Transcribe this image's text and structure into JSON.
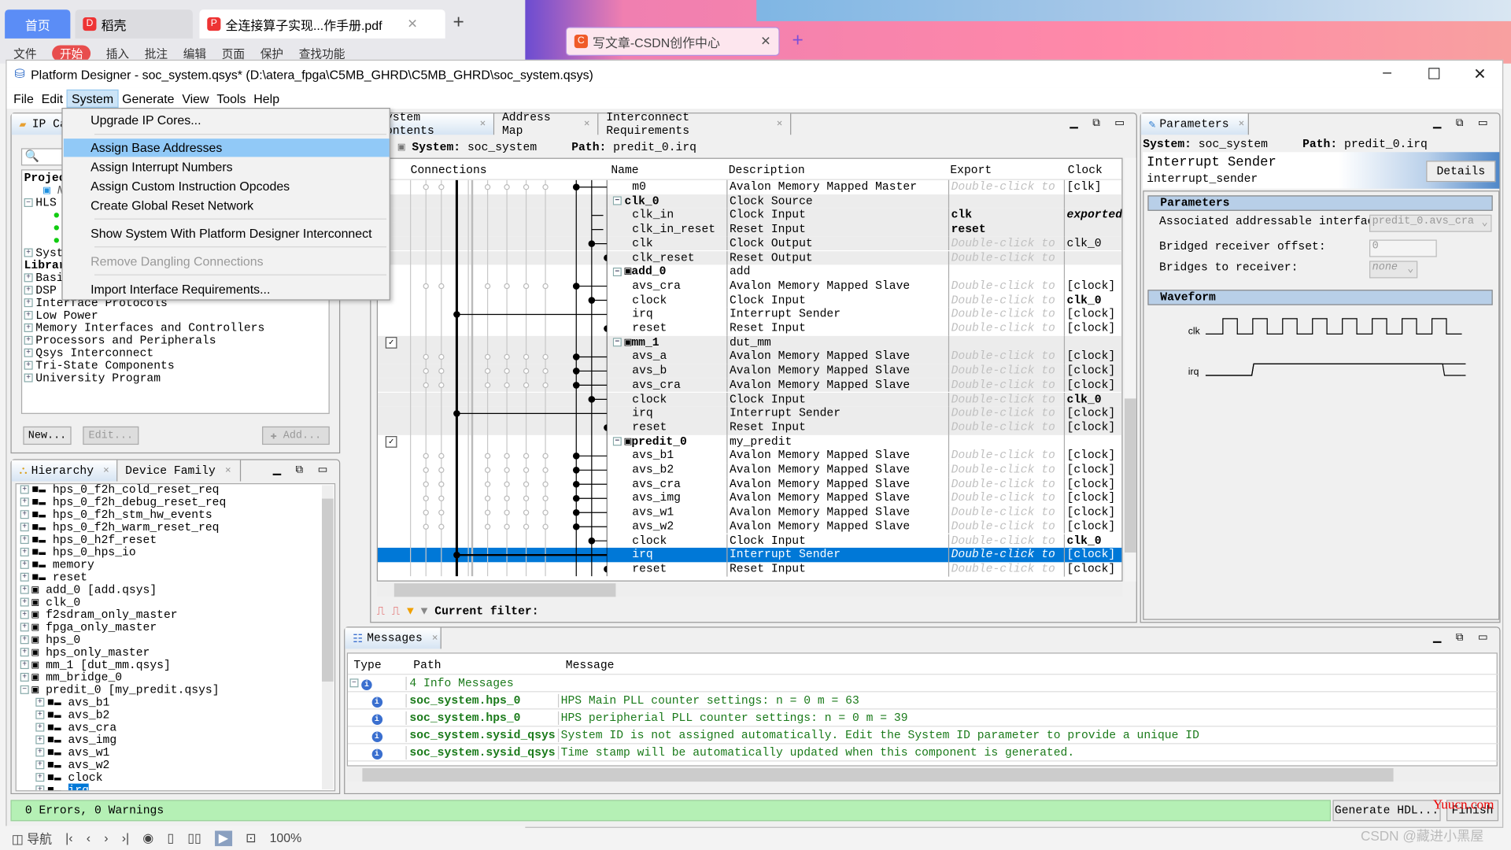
{
  "browser": {
    "tabs": [
      {
        "label": "首页"
      },
      {
        "label": "稻壳"
      },
      {
        "label": "全连接算子实现...作手册.pdf"
      }
    ],
    "toolbar": [
      "文件",
      "开始",
      "插入",
      "批注",
      "编辑",
      "页面",
      "保护",
      "查找功能"
    ],
    "csdn_tab": "写文章-CSDN创作中心"
  },
  "window": {
    "title": "Platform Designer - soc_system.qsys* (D:\\atera_fpga\\C5MB_GHRD\\C5MB_GHRD\\soc_system.qsys)",
    "menu": [
      "File",
      "Edit",
      "System",
      "Generate",
      "View",
      "Tools",
      "Help"
    ],
    "active_menu": "System"
  },
  "system_menu": {
    "items": [
      {
        "label": "Upgrade IP Cores...",
        "enabled": true
      },
      {
        "label": "Assign Base Addresses",
        "enabled": true,
        "highlighted": true
      },
      {
        "label": "Assign Interrupt Numbers",
        "enabled": true
      },
      {
        "label": "Assign Custom Instruction Opcodes",
        "enabled": true
      },
      {
        "label": "Create Global Reset Network",
        "enabled": true
      },
      {
        "label": "Show System With Platform Designer Interconnect",
        "enabled": true
      },
      {
        "label": "Remove Dangling Connections",
        "enabled": false
      },
      {
        "label": "Import Interface Requirements...",
        "enabled": true
      }
    ]
  },
  "ip_catalog": {
    "tab": "IP Catalog",
    "project_label": "Project",
    "project_items": [
      "HLS",
      "System"
    ],
    "library_label": "Library",
    "library_items": [
      "Basic Functions",
      "DSP",
      "Interface Protocols",
      "Low Power",
      "Memory Interfaces and Controllers",
      "Processors and Peripherals",
      "Qsys Interconnect",
      "Tri-State Components",
      "University Program"
    ],
    "buttons": {
      "new": "New...",
      "edit": "Edit...",
      "add": "Add..."
    }
  },
  "hierarchy": {
    "tabs": [
      "Hierarchy",
      "Device Family"
    ],
    "items": [
      "hps_0_f2h_cold_reset_req",
      "hps_0_f2h_debug_reset_req",
      "hps_0_f2h_stm_hw_events",
      "hps_0_f2h_warm_reset_req",
      "hps_0_h2f_reset",
      "hps_0_hps_io",
      "memory",
      "reset",
      "add_0 [add.qsys]",
      "clk_0",
      "f2sdram_only_master",
      "fpga_only_master",
      "hps_0",
      "hps_only_master",
      "mm_1 [dut_mm.qsys]",
      "mm_bridge_0",
      "predit_0 [my_predit.qsys]"
    ],
    "children": [
      "avs_b1",
      "avs_b2",
      "avs_cra",
      "avs_img",
      "avs_w1",
      "avs_w2",
      "clock",
      "irq"
    ],
    "selected": "irq"
  },
  "contents": {
    "tabs": [
      "System Contents",
      "Address Map",
      "Interconnect Requirements"
    ],
    "system_label": "System:",
    "system": "soc_system",
    "path_label": "Path:",
    "path": "predit_0.irq",
    "columns": [
      "Connections",
      "Name",
      "Description",
      "Export",
      "Clock"
    ],
    "rows": [
      {
        "name": "m0",
        "desc": "Avalon Memory Mapped Master",
        "export": "Double-click to",
        "clock": "[clk]",
        "kind": "port"
      },
      {
        "name": "clk_0",
        "desc": "Clock Source",
        "export": "",
        "clock": "",
        "kind": "module"
      },
      {
        "name": "clk_in",
        "desc": "Clock Input",
        "export": "clk",
        "clock": "exported",
        "kind": "port"
      },
      {
        "name": "clk_in_reset",
        "desc": "Reset Input",
        "export": "reset",
        "clock": "",
        "kind": "port"
      },
      {
        "name": "clk",
        "desc": "Clock Output",
        "export": "Double-click to",
        "clock": "clk_0",
        "kind": "port"
      },
      {
        "name": "clk_reset",
        "desc": "Reset Output",
        "export": "Double-click to",
        "clock": "",
        "kind": "port"
      },
      {
        "name": "add_0",
        "desc": "add",
        "export": "",
        "clock": "",
        "kind": "module"
      },
      {
        "name": "avs_cra",
        "desc": "Avalon Memory Mapped Slave",
        "export": "Double-click to",
        "clock": "[clock]",
        "kind": "port"
      },
      {
        "name": "clock",
        "desc": "Clock Input",
        "export": "Double-click to",
        "clock": "clk_0",
        "kind": "port"
      },
      {
        "name": "irq",
        "desc": "Interrupt Sender",
        "export": "Double-click to",
        "clock": "[clock]",
        "kind": "port"
      },
      {
        "name": "reset",
        "desc": "Reset Input",
        "export": "Double-click to",
        "clock": "[clock]",
        "kind": "port"
      },
      {
        "name": "mm_1",
        "desc": "dut_mm",
        "export": "",
        "clock": "",
        "kind": "module"
      },
      {
        "name": "avs_a",
        "desc": "Avalon Memory Mapped Slave",
        "export": "Double-click to",
        "clock": "[clock]",
        "kind": "port"
      },
      {
        "name": "avs_b",
        "desc": "Avalon Memory Mapped Slave",
        "export": "Double-click to",
        "clock": "[clock]",
        "kind": "port"
      },
      {
        "name": "avs_cra",
        "desc": "Avalon Memory Mapped Slave",
        "export": "Double-click to",
        "clock": "[clock]",
        "kind": "port"
      },
      {
        "name": "clock",
        "desc": "Clock Input",
        "export": "Double-click to",
        "clock": "clk_0",
        "kind": "port"
      },
      {
        "name": "irq",
        "desc": "Interrupt Sender",
        "export": "Double-click to",
        "clock": "[clock]",
        "kind": "port"
      },
      {
        "name": "reset",
        "desc": "Reset Input",
        "export": "Double-click to",
        "clock": "[clock]",
        "kind": "port"
      },
      {
        "name": "predit_0",
        "desc": "my_predit",
        "export": "",
        "clock": "",
        "kind": "module"
      },
      {
        "name": "avs_b1",
        "desc": "Avalon Memory Mapped Slave",
        "export": "Double-click to",
        "clock": "[clock]",
        "kind": "port"
      },
      {
        "name": "avs_b2",
        "desc": "Avalon Memory Mapped Slave",
        "export": "Double-click to",
        "clock": "[clock]",
        "kind": "port"
      },
      {
        "name": "avs_cra",
        "desc": "Avalon Memory Mapped Slave",
        "export": "Double-click to",
        "clock": "[clock]",
        "kind": "port"
      },
      {
        "name": "avs_img",
        "desc": "Avalon Memory Mapped Slave",
        "export": "Double-click to",
        "clock": "[clock]",
        "kind": "port"
      },
      {
        "name": "avs_w1",
        "desc": "Avalon Memory Mapped Slave",
        "export": "Double-click to",
        "clock": "[clock]",
        "kind": "port"
      },
      {
        "name": "avs_w2",
        "desc": "Avalon Memory Mapped Slave",
        "export": "Double-click to",
        "clock": "[clock]",
        "kind": "port"
      },
      {
        "name": "clock",
        "desc": "Clock Input",
        "export": "Double-click to",
        "clock": "clk_0",
        "kind": "port"
      },
      {
        "name": "irq",
        "desc": "Interrupt Sender",
        "export": "Double-click to",
        "clock": "[clock]",
        "kind": "port",
        "selected": true
      },
      {
        "name": "reset",
        "desc": "Reset Input",
        "export": "Double-click to",
        "clock": "[clock]",
        "kind": "port"
      }
    ],
    "filter_label": "Current filter:"
  },
  "parameters": {
    "tab": "Parameters",
    "system_label": "System:",
    "system": "soc_system",
    "path_label": "Path:",
    "path": "predit_0.irq",
    "title": "Interrupt Sender",
    "subtitle": "interrupt_sender",
    "details_button": "Details",
    "section_params": "Parameters",
    "fields": [
      {
        "label": "Associated addressable interface:",
        "value": "predit_0.avs_cra"
      },
      {
        "label": "Bridged receiver offset:",
        "value": "0"
      },
      {
        "label": "Bridges to receiver:",
        "value": "none"
      }
    ],
    "section_waveform": "Waveform",
    "waveform_signals": [
      "clk",
      "irq"
    ]
  },
  "messages": {
    "tab": "Messages",
    "columns": [
      "Type",
      "Path",
      "Message"
    ],
    "group": "4 Info Messages",
    "rows": [
      {
        "path": "soc_system.hps_0",
        "message": "HPS Main PLL counter settings: n = 0 m = 63"
      },
      {
        "path": "soc_system.hps_0",
        "message": "HPS peripherial PLL counter settings: n = 0 m = 39"
      },
      {
        "path": "soc_system.sysid_qsys",
        "message": "System ID is not assigned automatically. Edit the System ID parameter to provide a unique ID"
      },
      {
        "path": "soc_system.sysid_qsys",
        "message": "Time stamp will be automatically updated when this component is generated."
      }
    ]
  },
  "status": {
    "text": "0 Errors, 0 Warnings",
    "generate_button": "Generate HDL...",
    "finish_button": "Finish"
  },
  "bottom": {
    "nav_label": "导航",
    "zoom": "100%",
    "watermark": "CSDN @藏进小黑屋",
    "yuucn": "Yuucn.com"
  }
}
